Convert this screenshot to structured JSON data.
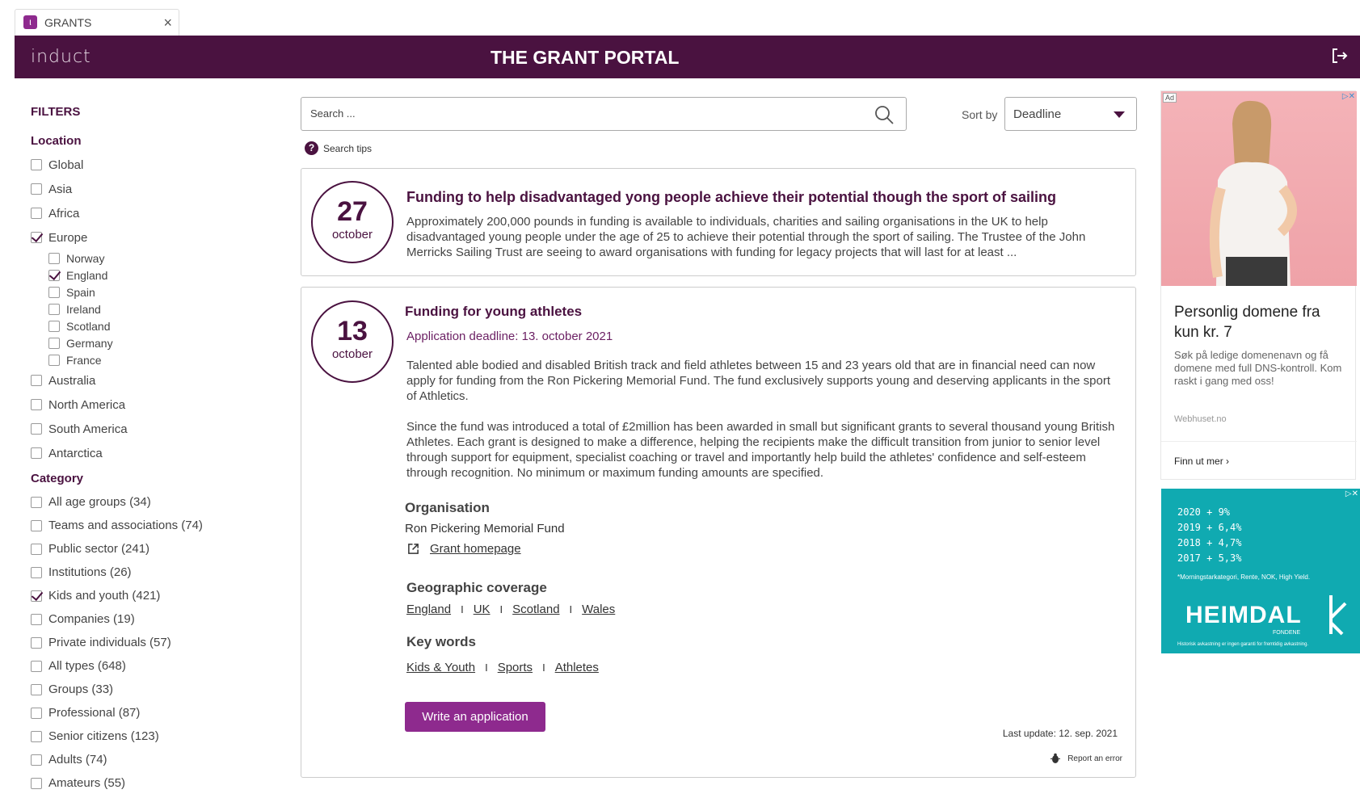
{
  "tab": {
    "label": "GRANTS",
    "close": "×",
    "icon": "app-icon"
  },
  "header": {
    "logo": "induct",
    "title": "THE GRANT PORTAL"
  },
  "filters": {
    "title": "FILTERS",
    "location_title": "Location",
    "locations": [
      {
        "label": "Global",
        "checked": false
      },
      {
        "label": "Asia",
        "checked": false
      },
      {
        "label": "Africa",
        "checked": false
      },
      {
        "label": "Europe",
        "checked": true
      }
    ],
    "europe_sub": [
      {
        "label": "Norway",
        "checked": false
      },
      {
        "label": "England",
        "checked": true
      },
      {
        "label": "Spain",
        "checked": false
      },
      {
        "label": "Ireland",
        "checked": false
      },
      {
        "label": "Scotland",
        "checked": false
      },
      {
        "label": "Germany",
        "checked": false
      },
      {
        "label": "France",
        "checked": false
      }
    ],
    "locations_more": [
      {
        "label": "Australia",
        "checked": false
      },
      {
        "label": "North America",
        "checked": false
      },
      {
        "label": "South America",
        "checked": false
      },
      {
        "label": "Antarctica",
        "checked": false
      }
    ],
    "category_title": "Category",
    "categories": [
      {
        "label": "All age groups (34)",
        "checked": false
      },
      {
        "label": "Teams and associations (74)",
        "checked": false
      },
      {
        "label": "Public sector (241)",
        "checked": false
      },
      {
        "label": "Institutions (26)",
        "checked": false
      },
      {
        "label": "Kids and youth (421)",
        "checked": true
      },
      {
        "label": "Companies (19)",
        "checked": false
      },
      {
        "label": "Private individuals (57)",
        "checked": false
      },
      {
        "label": "All types (648)",
        "checked": false
      },
      {
        "label": "Groups (33)",
        "checked": false
      },
      {
        "label": "Professional (87)",
        "checked": false
      },
      {
        "label": "Senior citizens (123)",
        "checked": false
      },
      {
        "label": "Adults (74)",
        "checked": false
      },
      {
        "label": "Amateurs (55)",
        "checked": false
      }
    ]
  },
  "search": {
    "placeholder": "Search ...",
    "tips": "Search tips"
  },
  "sort": {
    "label": "Sort by",
    "value": "Deadline"
  },
  "grant1": {
    "day": "27",
    "month": "october",
    "title": "Funding to help disadvantaged yong people achieve their potential though the sport of sailing",
    "body": "Approximately 200,000 pounds in funding is available to individuals, charities and sailing organisations in the UK to help disadvantaged young people under the age of 25 to achieve their potential through the sport of sailing. The Trustee of the John Merricks Sailing Trust are seeing to award organisations with funding for legacy projects that will last for at least ..."
  },
  "grant2": {
    "day": "13",
    "month": "october",
    "title": "Funding for young athletes",
    "deadline": "Application deadline: 13. october 2021",
    "para1": "Talented able bodied and disabled British track and field athletes between 15 and 23 years old that are in financial need can now apply for funding from the Ron Pickering Memorial Fund. The fund exclusively supports young and deserving applicants in the sport of Athletics.",
    "para2": "Since the fund was introduced a total of £2million has been awarded in small but significant grants to several thousand young British Athletes. Each grant is designed to make a difference, helping the recipients make the difficult transition from junior to senior level through support for equipment, specialist coaching or travel and importantly help build the athletes' confidence and self-esteem through recognition. No minimum or maximum funding amounts are specified.",
    "org_label": "Organisation",
    "org_name": "Ron Pickering Memorial Fund",
    "homepage": "Grant homepage",
    "geo_label": "Geographic coverage",
    "geo": [
      "England",
      "UK",
      "Scotland",
      "Wales"
    ],
    "kw_label": "Key words",
    "keywords": [
      "Kids & Youth",
      "Sports",
      "Athletes"
    ],
    "separator": "I",
    "write_button": "Write an application",
    "last_update": "Last update: 12. sep. 2021",
    "report": "Report an error"
  },
  "ad1": {
    "tag": "Ad",
    "title": "Personlig domene fra kun kr. 7",
    "text": "Søk på ledige domenenavn og få domene med full DNS-kontroll. Kom raskt i gang med oss!",
    "domain": "Webhuset.no",
    "cta": "Finn ut mer"
  },
  "ad2": {
    "lines": [
      "2020 + 9%",
      "2019 + 6,4%",
      "2018 + 4,7%",
      "2017 + 5,3%"
    ],
    "note": "*Morningstarkategori, Rente, NOK, High Yield.",
    "brand": "HEIMDAL",
    "sub": "FONDENE",
    "foot": "Historisk avkastning er ingen garanti for fremtidig avkastning."
  },
  "colors": {
    "brand": "#4a1240",
    "button": "#8e2a8e",
    "ad_teal": "#10aab1",
    "ad_pink": "#f4b3b8"
  }
}
